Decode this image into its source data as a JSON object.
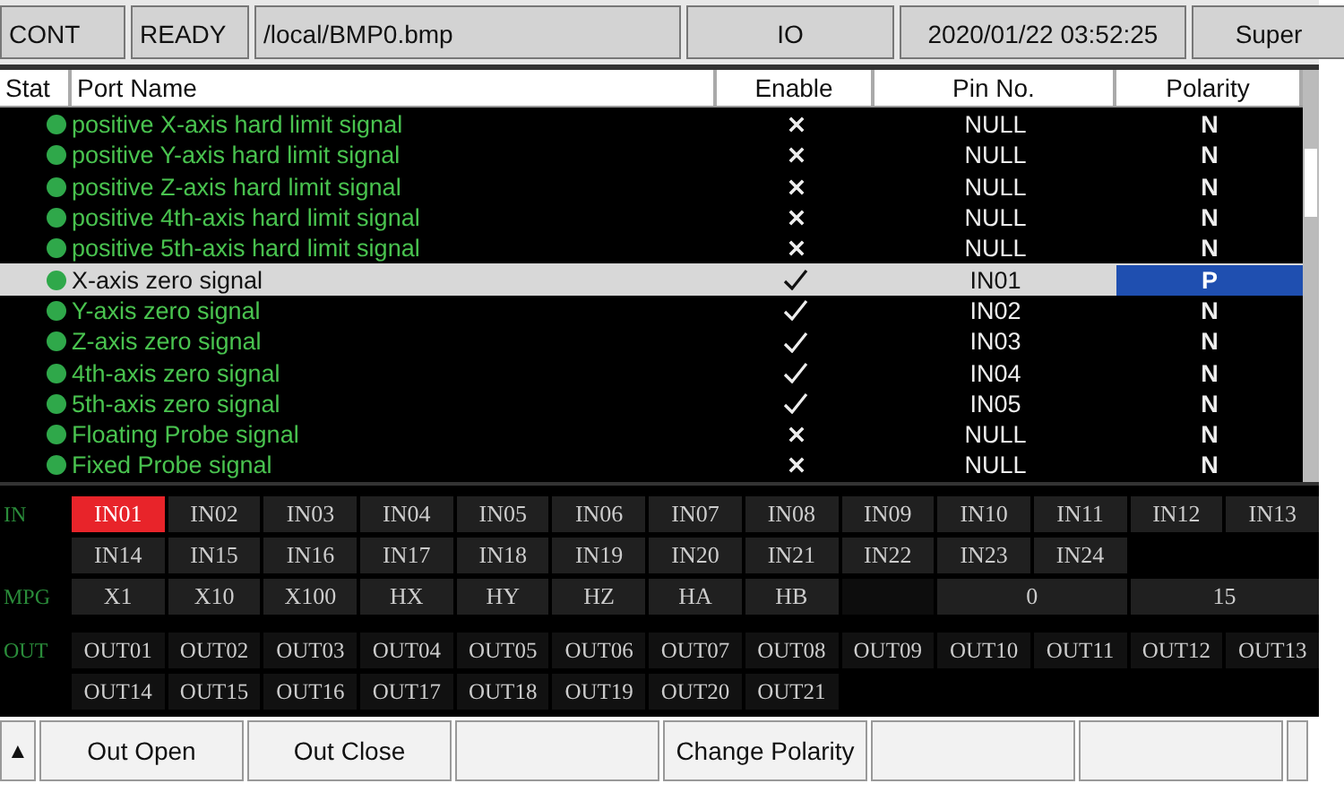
{
  "status_bar": [
    "CONT",
    "READY",
    "/local/BMP0.bmp",
    "IO",
    "2020/01/22 03:52:25",
    "Super"
  ],
  "table": {
    "columns": [
      "Stat",
      "Port Name",
      "Enable",
      "Pin No.",
      "Polarity"
    ],
    "rows": [
      {
        "name": "positive X-axis hard limit signal",
        "enabled": false,
        "pin": "NULL",
        "polarity": "N",
        "selected": false,
        "color": "#2fa84a"
      },
      {
        "name": "positive Y-axis hard limit signal",
        "enabled": false,
        "pin": "NULL",
        "polarity": "N",
        "selected": false,
        "color": "#2fa84a"
      },
      {
        "name": "positive Z-axis hard limit signal",
        "enabled": false,
        "pin": "NULL",
        "polarity": "N",
        "selected": false,
        "color": "#2fa84a"
      },
      {
        "name": "positive 4th-axis hard limit signal",
        "enabled": false,
        "pin": "NULL",
        "polarity": "N",
        "selected": false,
        "color": "#2fa84a"
      },
      {
        "name": "positive 5th-axis hard limit signal",
        "enabled": false,
        "pin": "NULL",
        "polarity": "N",
        "selected": false,
        "color": "#2fa84a"
      },
      {
        "name": "X-axis zero signal",
        "enabled": true,
        "pin": "IN01",
        "polarity": "P",
        "selected": true,
        "color": "#2fa84a"
      },
      {
        "name": "Y-axis zero signal",
        "enabled": true,
        "pin": "IN02",
        "polarity": "N",
        "selected": false,
        "color": "#2fa84a"
      },
      {
        "name": "Z-axis zero signal",
        "enabled": true,
        "pin": "IN03",
        "polarity": "N",
        "selected": false,
        "color": "#2fa84a"
      },
      {
        "name": "4th-axis zero signal",
        "enabled": true,
        "pin": "IN04",
        "polarity": "N",
        "selected": false,
        "color": "#2fa84a"
      },
      {
        "name": "5th-axis zero signal",
        "enabled": true,
        "pin": "IN05",
        "polarity": "N",
        "selected": false,
        "color": "#2fa84a"
      },
      {
        "name": "Floating Probe signal",
        "enabled": false,
        "pin": "NULL",
        "polarity": "N",
        "selected": false,
        "color": "#2fa84a"
      },
      {
        "name": "Fixed Probe signal",
        "enabled": false,
        "pin": "NULL",
        "polarity": "N",
        "selected": false,
        "color": "#2fa84a"
      }
    ]
  },
  "inputs": {
    "label": "IN",
    "items": [
      {
        "label": "IN01",
        "on": true
      },
      {
        "label": "IN02",
        "on": false
      },
      {
        "label": "IN03",
        "on": false
      },
      {
        "label": "IN04",
        "on": false
      },
      {
        "label": "IN05",
        "on": false
      },
      {
        "label": "IN06",
        "on": false
      },
      {
        "label": "IN07",
        "on": false
      },
      {
        "label": "IN08",
        "on": false
      },
      {
        "label": "IN09",
        "on": false
      },
      {
        "label": "IN10",
        "on": false
      },
      {
        "label": "IN11",
        "on": false
      },
      {
        "label": "IN12",
        "on": false
      },
      {
        "label": "IN13",
        "on": false
      },
      {
        "label": "IN14",
        "on": false
      },
      {
        "label": "IN15",
        "on": false
      },
      {
        "label": "IN16",
        "on": false
      },
      {
        "label": "IN17",
        "on": false
      },
      {
        "label": "IN18",
        "on": false
      },
      {
        "label": "IN19",
        "on": false
      },
      {
        "label": "IN20",
        "on": false
      },
      {
        "label": "IN21",
        "on": false
      },
      {
        "label": "IN22",
        "on": false
      },
      {
        "label": "IN23",
        "on": false
      },
      {
        "label": "IN24",
        "on": false
      }
    ]
  },
  "mpg": {
    "label": "MPG",
    "items": [
      "X1",
      "X10",
      "X100",
      "HX",
      "HY",
      "HZ",
      "HA",
      "HB"
    ],
    "value_1": "0",
    "value_2": "15"
  },
  "outputs": {
    "label": "OUT",
    "items": [
      {
        "label": "OUT01",
        "on": false
      },
      {
        "label": "OUT02",
        "on": false
      },
      {
        "label": "OUT03",
        "on": false
      },
      {
        "label": "OUT04",
        "on": false
      },
      {
        "label": "OUT05",
        "on": false
      },
      {
        "label": "OUT06",
        "on": false
      },
      {
        "label": "OUT07",
        "on": false
      },
      {
        "label": "OUT08",
        "on": false
      },
      {
        "label": "OUT09",
        "on": false
      },
      {
        "label": "OUT10",
        "on": false
      },
      {
        "label": "OUT11",
        "on": false
      },
      {
        "label": "OUT12",
        "on": false
      },
      {
        "label": "OUT13",
        "on": false
      },
      {
        "label": "OUT14",
        "on": false
      },
      {
        "label": "OUT15",
        "on": false
      },
      {
        "label": "OUT16",
        "on": false
      },
      {
        "label": "OUT17",
        "on": false
      },
      {
        "label": "OUT18",
        "on": false
      },
      {
        "label": "OUT19",
        "on": false
      },
      {
        "label": "OUT20",
        "on": false
      },
      {
        "label": "OUT21",
        "on": false
      }
    ]
  },
  "softkeys": {
    "arrow": "▲",
    "buttons": [
      {
        "kind": "text",
        "label": "Out Open"
      },
      {
        "kind": "text",
        "label": "Out Close"
      },
      {
        "kind": "blank"
      },
      {
        "kind": "text",
        "label": "Change Polarity"
      },
      {
        "kind": "blank"
      },
      {
        "kind": "blank"
      }
    ]
  }
}
